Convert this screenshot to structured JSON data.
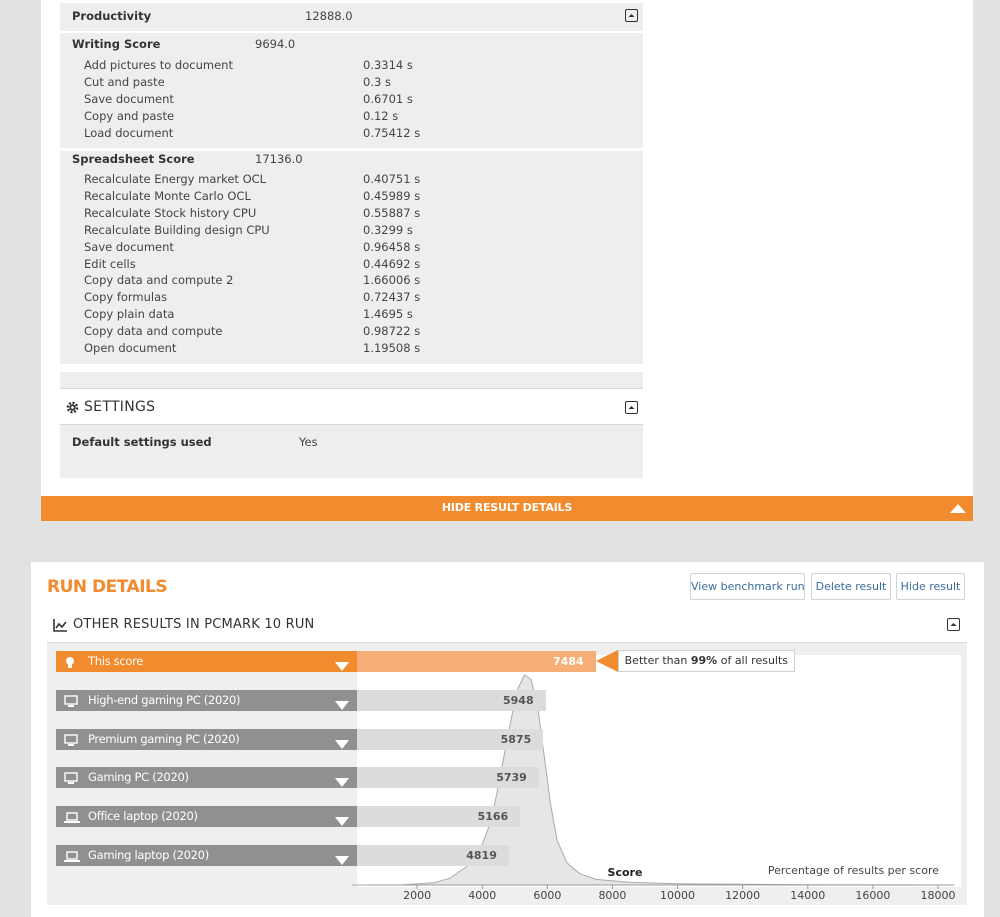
{
  "productivity": {
    "label": "Productivity",
    "value": "12888.0"
  },
  "writing": {
    "label": "Writing Score",
    "value": "9694.0",
    "items": [
      {
        "label": "Add pictures to document",
        "value": "0.3314 s"
      },
      {
        "label": "Cut and paste",
        "value": "0.3 s"
      },
      {
        "label": "Save document",
        "value": "0.6701 s"
      },
      {
        "label": "Copy and paste",
        "value": "0.12 s"
      },
      {
        "label": "Load document",
        "value": "0.75412 s"
      }
    ]
  },
  "spreadsheet": {
    "label": "Spreadsheet Score",
    "value": "17136.0",
    "items": [
      {
        "label": "Recalculate Energy market OCL",
        "value": "0.40751 s"
      },
      {
        "label": "Recalculate Monte Carlo OCL",
        "value": "0.45989 s"
      },
      {
        "label": "Recalculate Stock history CPU",
        "value": "0.55887 s"
      },
      {
        "label": "Recalculate Building design CPU",
        "value": "0.3299 s"
      },
      {
        "label": "Save document",
        "value": "0.96458 s"
      },
      {
        "label": "Edit cells",
        "value": "0.44692 s"
      },
      {
        "label": "Copy data and compute 2",
        "value": "1.66006 s"
      },
      {
        "label": "Copy formulas",
        "value": "0.72437 s"
      },
      {
        "label": "Copy plain data",
        "value": "1.4695 s"
      },
      {
        "label": "Copy data and compute",
        "value": "0.98722 s"
      },
      {
        "label": "Open document",
        "value": "1.19508 s"
      }
    ]
  },
  "settings": {
    "title": "SETTINGS",
    "default_label": "Default settings used",
    "default_value": "Yes"
  },
  "hide_bar_label": "HIDE RESULT DETAILS",
  "run_details": {
    "title": "RUN DETAILS",
    "buttons": {
      "view": "View benchmark run",
      "delete": "Delete result",
      "hide": "Hide result"
    },
    "other_title": "OTHER RESULTS IN PCMARK 10 RUN",
    "better_prefix": "Better than ",
    "better_pct": "99%",
    "better_suffix": " of all results"
  },
  "colors": {
    "accent": "#f28a2e",
    "accent_light": "#f7ae76",
    "bar_gray": "#909090",
    "link": "#3a6e9c"
  },
  "chart_data": {
    "type": "area",
    "xlabel": "Score",
    "ylabel": "Percentage of results per score",
    "xlim": [
      0,
      18500
    ],
    "x_ticks": [
      "2000",
      "4000",
      "6000",
      "8000",
      "10000",
      "12000",
      "14000",
      "16000",
      "18000"
    ],
    "distribution": [
      [
        0,
        0
      ],
      [
        1500,
        0
      ],
      [
        2500,
        1
      ],
      [
        3000,
        3
      ],
      [
        3500,
        8
      ],
      [
        4000,
        18
      ],
      [
        4300,
        30
      ],
      [
        4500,
        45
      ],
      [
        4700,
        60
      ],
      [
        4900,
        75
      ],
      [
        5100,
        88
      ],
      [
        5300,
        94
      ],
      [
        5500,
        92
      ],
      [
        5700,
        80
      ],
      [
        5900,
        58
      ],
      [
        6100,
        36
      ],
      [
        6300,
        20
      ],
      [
        6600,
        10
      ],
      [
        7000,
        5
      ],
      [
        7500,
        2.5
      ],
      [
        8500,
        1.2
      ],
      [
        10000,
        0.6
      ],
      [
        12000,
        0.3
      ],
      [
        14000,
        0.15
      ],
      [
        16000,
        0.05
      ],
      [
        18500,
        0
      ]
    ],
    "comparisons": [
      {
        "name": "This score",
        "value": 7484,
        "icon": "bulb-icon",
        "highlight": true
      },
      {
        "name": "High-end gaming PC (2020)",
        "value": 5948,
        "icon": "desktop-icon"
      },
      {
        "name": "Premium gaming PC (2020)",
        "value": 5875,
        "icon": "desktop-icon"
      },
      {
        "name": "Gaming PC (2020)",
        "value": 5739,
        "icon": "desktop-icon"
      },
      {
        "name": "Office laptop (2020)",
        "value": 5166,
        "icon": "laptop-icon"
      },
      {
        "name": "Gaming laptop (2020)",
        "value": 4819,
        "icon": "laptop-icon"
      }
    ]
  }
}
